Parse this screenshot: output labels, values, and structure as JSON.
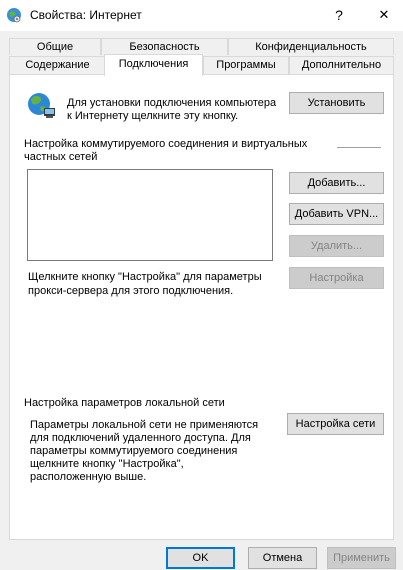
{
  "window": {
    "title": "Свойства: Интернет",
    "help_label": "?",
    "close_label": "✕"
  },
  "tabs_row1": [
    {
      "label": "Общие"
    },
    {
      "label": "Безопасность"
    },
    {
      "label": "Конфиденциальность"
    }
  ],
  "tabs_row2": [
    {
      "label": "Содержание"
    },
    {
      "label": "Подключения",
      "active": true
    },
    {
      "label": "Программы"
    },
    {
      "label": "Дополнительно"
    }
  ],
  "setup": {
    "text_line1": "Для установки подключения компьютера",
    "text_line2": "к Интернету щелкните эту кнопку.",
    "button": "Установить"
  },
  "dialup": {
    "heading_line1": "Настройка коммутируемого соединения и виртуальных",
    "heading_line2": "частных сетей",
    "add_button": "Добавить...",
    "add_vpn_button": "Добавить VPN...",
    "remove_button": "Удалить...",
    "settings_button": "Настройка",
    "proxy_line1": "Щелкните кнопку \"Настройка\" для параметры",
    "proxy_line2": "прокси-сервера для этого подключения."
  },
  "lan": {
    "heading": "Настройка параметров локальной сети",
    "text_line1": "Параметры локальной сети не применяются",
    "text_line2": "для подключений удаленного доступа. Для",
    "text_line3": "параметры коммутируемого соединения",
    "text_line4": "щелкните кнопку \"Настройка\",",
    "text_line5": "расположенную выше.",
    "button": "Настройка сети"
  },
  "footer": {
    "ok": "OK",
    "cancel": "Отмена",
    "apply": "Применить"
  }
}
